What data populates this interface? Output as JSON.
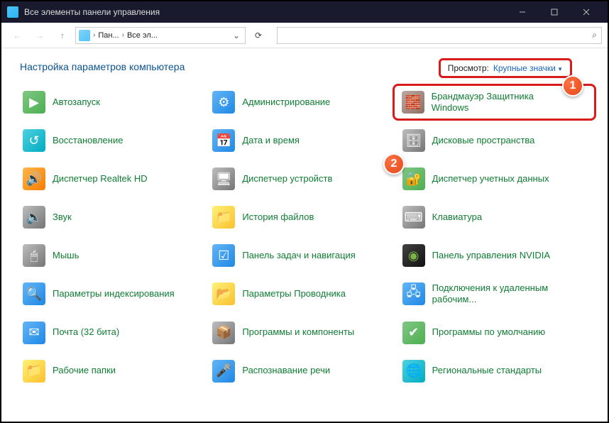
{
  "titlebar": {
    "title": "Все элементы панели управления"
  },
  "breadcrumb": {
    "crumb1": "Пан...",
    "crumb2": "Все эл..."
  },
  "header": {
    "page_title": "Настройка параметров компьютера",
    "view_label": "Просмотр:",
    "view_value": "Крупные значки"
  },
  "callouts": {
    "one": "1",
    "two": "2"
  },
  "items": [
    {
      "label": "Автозапуск",
      "icon": "autoplay-icon",
      "cls": "i-green",
      "glyph": "▶"
    },
    {
      "label": "Администрирование",
      "icon": "admin-tools-icon",
      "cls": "i-blue",
      "glyph": "⚙"
    },
    {
      "label": "Брандмауэр Защитника Windows",
      "icon": "firewall-icon",
      "cls": "i-brown",
      "glyph": "🧱",
      "highlight": true
    },
    {
      "label": "Восстановление",
      "icon": "recovery-icon",
      "cls": "i-teal",
      "glyph": "↺"
    },
    {
      "label": "Дата и время",
      "icon": "date-time-icon",
      "cls": "i-blue",
      "glyph": "📅"
    },
    {
      "label": "Дисковые пространства",
      "icon": "storage-spaces-icon",
      "cls": "i-grey",
      "glyph": "🗄"
    },
    {
      "label": "Диспетчер Realtek HD",
      "icon": "realtek-icon",
      "cls": "i-orange",
      "glyph": "🔊"
    },
    {
      "label": "Диспетчер устройств",
      "icon": "device-manager-icon",
      "cls": "i-grey",
      "glyph": "🖥"
    },
    {
      "label": "Диспетчер учетных данных",
      "icon": "credential-manager-icon",
      "cls": "i-green",
      "glyph": "🔐"
    },
    {
      "label": "Звук",
      "icon": "sound-icon",
      "cls": "i-grey",
      "glyph": "🔈"
    },
    {
      "label": "История файлов",
      "icon": "file-history-icon",
      "cls": "i-yellow",
      "glyph": "📁"
    },
    {
      "label": "Клавиатура",
      "icon": "keyboard-icon",
      "cls": "i-grey",
      "glyph": "⌨"
    },
    {
      "label": "Мышь",
      "icon": "mouse-icon",
      "cls": "i-grey",
      "glyph": "🖱"
    },
    {
      "label": "Панель задач и навигация",
      "icon": "taskbar-icon",
      "cls": "i-blue",
      "glyph": "☑"
    },
    {
      "label": "Панель управления NVIDIA",
      "icon": "nvidia-icon",
      "cls": "i-black",
      "glyph": "◉"
    },
    {
      "label": "Параметры индексирования",
      "icon": "indexing-icon",
      "cls": "i-blue",
      "glyph": "🔍"
    },
    {
      "label": "Параметры Проводника",
      "icon": "explorer-options-icon",
      "cls": "i-yellow",
      "glyph": "📂"
    },
    {
      "label": "Подключения к удаленным рабочим...",
      "icon": "remote-desktop-icon",
      "cls": "i-blue",
      "glyph": "🖧"
    },
    {
      "label": "Почта (32 бита)",
      "icon": "mail-icon",
      "cls": "i-blue",
      "glyph": "✉"
    },
    {
      "label": "Программы и компоненты",
      "icon": "programs-icon",
      "cls": "i-grey",
      "glyph": "📦"
    },
    {
      "label": "Программы по умолчанию",
      "icon": "default-programs-icon",
      "cls": "i-green",
      "glyph": "✔"
    },
    {
      "label": "Рабочие папки",
      "icon": "work-folders-icon",
      "cls": "i-yellow",
      "glyph": "📁"
    },
    {
      "label": "Распознавание речи",
      "icon": "speech-icon",
      "cls": "i-blue",
      "glyph": "🎤"
    },
    {
      "label": "Региональные стандарты",
      "icon": "region-icon",
      "cls": "i-teal",
      "glyph": "🌐"
    }
  ]
}
